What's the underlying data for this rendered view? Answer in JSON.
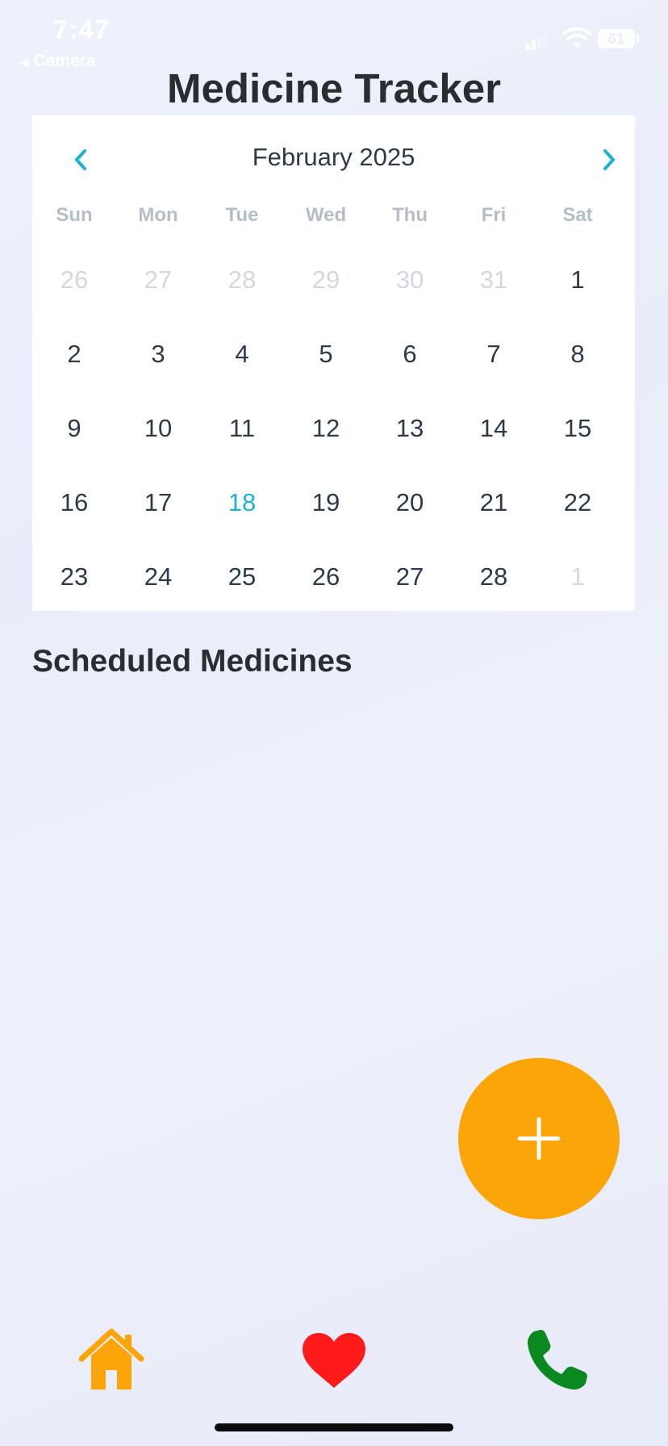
{
  "status_bar": {
    "time": "7:47",
    "back_label": "Camera",
    "battery": "61"
  },
  "header": {
    "title": "Medicine Tracker"
  },
  "calendar": {
    "month_label": "February 2025",
    "weekdays": [
      "Sun",
      "Mon",
      "Tue",
      "Wed",
      "Thu",
      "Fri",
      "Sat"
    ],
    "weeks": [
      [
        {
          "day": "26",
          "muted": true
        },
        {
          "day": "27",
          "muted": true
        },
        {
          "day": "28",
          "muted": true
        },
        {
          "day": "29",
          "muted": true
        },
        {
          "day": "30",
          "muted": true
        },
        {
          "day": "31",
          "muted": true
        },
        {
          "day": "1"
        }
      ],
      [
        {
          "day": "2"
        },
        {
          "day": "3"
        },
        {
          "day": "4"
        },
        {
          "day": "5"
        },
        {
          "day": "6"
        },
        {
          "day": "7"
        },
        {
          "day": "8"
        }
      ],
      [
        {
          "day": "9"
        },
        {
          "day": "10"
        },
        {
          "day": "11"
        },
        {
          "day": "12"
        },
        {
          "day": "13"
        },
        {
          "day": "14"
        },
        {
          "day": "15"
        }
      ],
      [
        {
          "day": "16"
        },
        {
          "day": "17"
        },
        {
          "day": "18",
          "today": true
        },
        {
          "day": "19"
        },
        {
          "day": "20"
        },
        {
          "day": "21"
        },
        {
          "day": "22"
        }
      ],
      [
        {
          "day": "23"
        },
        {
          "day": "24"
        },
        {
          "day": "25"
        },
        {
          "day": "26"
        },
        {
          "day": "27"
        },
        {
          "day": "28"
        },
        {
          "day": "1",
          "muted": true
        }
      ]
    ],
    "accent_color": "#1ab2d6"
  },
  "main": {
    "section_title": "Scheduled Medicines"
  },
  "fab": {
    "icon": "plus-icon",
    "color": "#fca509"
  },
  "bottom_nav": {
    "items": [
      {
        "icon": "home-icon",
        "color": "#fca509"
      },
      {
        "icon": "heart-icon",
        "color": "#ff1a1a"
      },
      {
        "icon": "phone-icon",
        "color": "#0a8a1e"
      }
    ]
  }
}
